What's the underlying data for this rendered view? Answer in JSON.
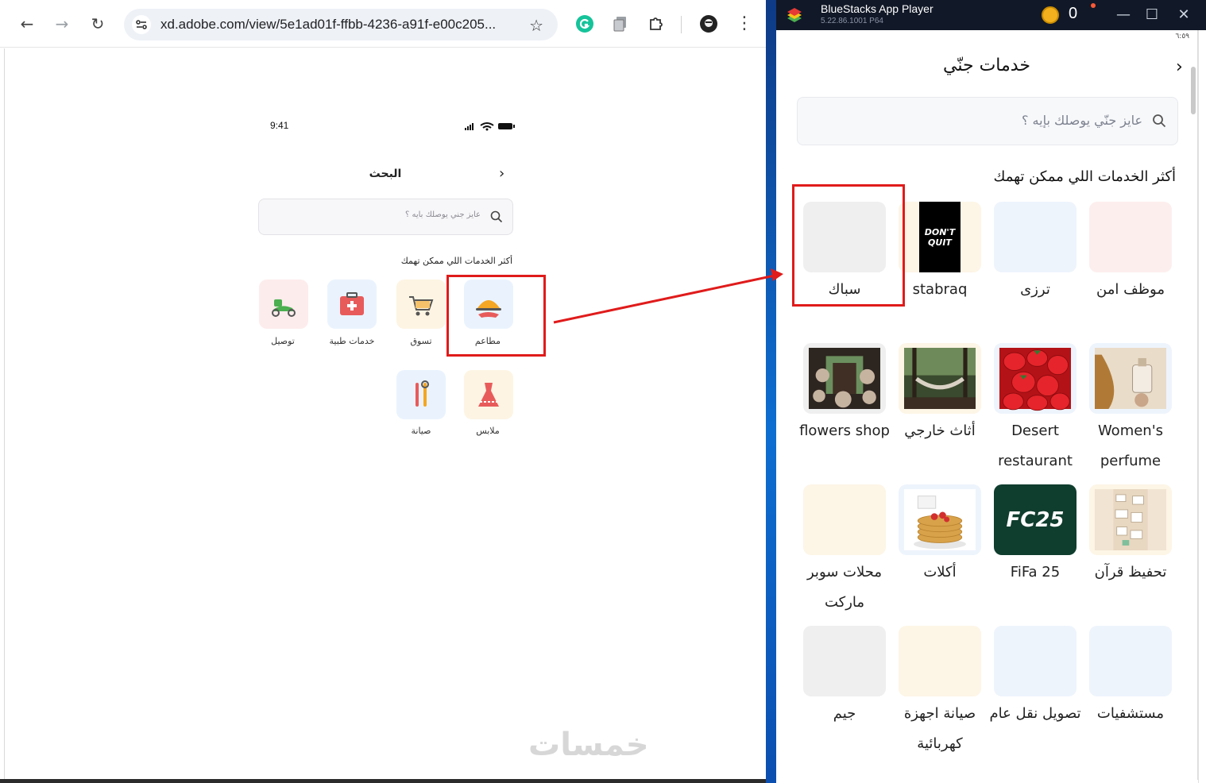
{
  "browser": {
    "url": "xd.adobe.com/view/5e1ad01f-ffbb-4236-a91f-e00c205...",
    "nav_back_icon": "←",
    "nav_forward_icon": "→",
    "reload_icon": "↻",
    "bookmark_icon": "☆",
    "menu_icon": "⋮"
  },
  "phone": {
    "time": "9:41",
    "title": "البحث",
    "search_placeholder": "عايز جني يوصلك بايه ؟",
    "section_title": "أكثر الخدمات اللي ممكن تهمك",
    "services": [
      {
        "label": "مطاعم",
        "icon": "restaurant-icon",
        "tint": "#eaf3fd"
      },
      {
        "label": "تسوق",
        "icon": "cart-icon",
        "tint": "#fdf4e3"
      },
      {
        "label": "خدمات طبية",
        "icon": "first-aid-icon",
        "tint": "#eaf3fd"
      },
      {
        "label": "توصيل",
        "icon": "scooter-icon",
        "tint": "#fdecec"
      },
      {
        "label": "ملابس",
        "icon": "dress-icon",
        "tint": "#fdf4e3"
      },
      {
        "label": "صيانة",
        "icon": "tools-icon",
        "tint": "#eaf3fd"
      }
    ]
  },
  "watermark": "خمسات",
  "bluestacks": {
    "app_name": "BlueStacks App Player",
    "version": "5.22.86.1001 P64",
    "coins": "0",
    "minimize_icon": "—",
    "maximize_icon": "☐",
    "close_icon": "✕"
  },
  "app": {
    "status_time": "٦:٥٩",
    "title": "خدمات جنّي",
    "search_placeholder": "عايز جنّي يوصلك بإيه ؟",
    "section_title": "أكثر الخدمات اللي ممكن تهمك",
    "rows": [
      [
        {
          "label": "موظف امن",
          "tint": "#fdeeee"
        },
        {
          "label": "ترزى",
          "tint": "#eef4fc"
        },
        {
          "label": "stabraq",
          "tint": "#fdf5e6",
          "image_text": "DON'T QUIT"
        },
        {
          "label": "سباك",
          "tint": "#efefef"
        }
      ],
      [
        {
          "label": "Women's perfume",
          "tint": "#eef4fc",
          "image": "perfume"
        },
        {
          "label": "Desert restaurant",
          "tint": "#eef4fc",
          "image": "strawberries"
        },
        {
          "label": "أثاث خارجي",
          "tint": "#fdf5e6",
          "image": "hammock"
        },
        {
          "label": "flowers shop",
          "tint": "#efefef",
          "image": "flower-shop"
        }
      ],
      [
        {
          "label": "تحفيظ قرآن",
          "tint": "#fdf5e6",
          "image": "notes"
        },
        {
          "label": "FiFa 25",
          "tint": "#eef4fc",
          "image_text": "FC25"
        },
        {
          "label": "أكلات",
          "tint": "#eef4fc",
          "image": "pancakes"
        },
        {
          "label": "محلات سوبر ماركت",
          "tint": "#fdf5e6"
        }
      ],
      [
        {
          "label": "مستشفيات",
          "tint": "#eef4fc"
        },
        {
          "label": "تصويل نقل عام",
          "tint": "#eef4fc"
        },
        {
          "label": "صيانة اجهزة كهربائية",
          "tint": "#fdf5e6"
        },
        {
          "label": "جيم",
          "tint": "#efefef"
        }
      ]
    ]
  },
  "colors": {
    "annotation_red": "#e01b1b",
    "bluestacks_titlebar": "#111827"
  }
}
